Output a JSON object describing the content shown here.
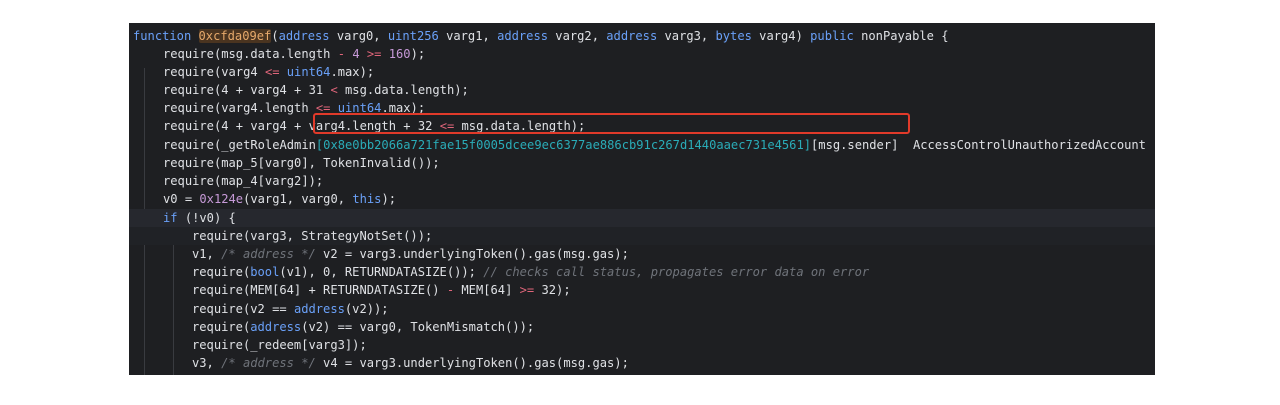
{
  "code": {
    "l1": {
      "kw": "function",
      "fname": "0xcfda09ef",
      "p1": "(",
      "t1": "address",
      "a1": " varg0, ",
      "t2": "uint256",
      "a2": " varg1, ",
      "t3": "address",
      "a3": " varg2, ",
      "t4": "address",
      "a4": " varg3, ",
      "t5": "bytes",
      "a5": " varg4) ",
      "k2": "public",
      "a6": " nonPayable {"
    },
    "l2": {
      "f": "require",
      "a": "(msg.data.length ",
      "op1": "-",
      "b": " ",
      "n1": "4",
      "c": " ",
      "op2": ">=",
      "d": " ",
      "n2": "160",
      "e": ");"
    },
    "l3": {
      "f": "require",
      "a": "(varg4 ",
      "op": "<=",
      "b": " ",
      "t": "uint64",
      "c": ".max);"
    },
    "l4": {
      "f": "require",
      "a": "(4 + varg4 + 31 ",
      "op": "<",
      "b": " msg.data.length);"
    },
    "l5": {
      "f": "require",
      "a": "(varg4.length ",
      "op": "<=",
      "b": " ",
      "t": "uint64",
      "c": ".max);"
    },
    "l6": {
      "f": "require",
      "a": "(4 + varg4 + varg4.length + 32 ",
      "op": "<=",
      "b": " msg.data.length);"
    },
    "l7": {
      "f": "require",
      "a": "(_getRoleAdmin",
      "hex": "[0x8e0bb2066a721fae15f0005dcee9ec6377ae886cb91c267d1440aaec731e4561]",
      "b": "[msg.sender]",
      "c": "  AccessControlUnauthorizedAccount"
    },
    "l8": {
      "f": "require",
      "a": "(map_5[varg0], TokenInvalid());"
    },
    "l9": {
      "f": "require",
      "a": "(map_4[varg2]);"
    },
    "l10": {
      "a": "v0 = ",
      "n": "0x124e",
      "b": "(varg1, varg0, ",
      "k": "this",
      "c": ");"
    },
    "l11": {
      "k": "if",
      "a": " (!v0) {"
    },
    "l12": {
      "f": "require",
      "a": "(varg3, StrategyNotSet());"
    },
    "l13": {
      "a": "v1, ",
      "c1": "/* address */",
      "b": " v2 = varg3.underlyingToken().gas(msg.gas);"
    },
    "l14": {
      "f": "require",
      "a": "(",
      "t": "bool",
      "b": "(v1), 0, RETURNDATASIZE()); ",
      "c": "// checks call status, propagates error data on error"
    },
    "l15": {
      "f": "require",
      "a": "(MEM[64] + RETURNDATASIZE() ",
      "op1": "-",
      "b": " MEM[64] ",
      "op2": ">=",
      "c": " 32);"
    },
    "l16": {
      "f": "require",
      "a": "(v2 == ",
      "t": "address",
      "b": "(v2));"
    },
    "l17": {
      "f": "require",
      "a": "(",
      "t": "address",
      "b": "(v2) == varg0, TokenMismatch());"
    },
    "l18": {
      "f": "require",
      "a": "(_redeem[varg3]);"
    },
    "l19": {
      "a": "v3, ",
      "c1": "/* address */",
      "b": " v4 = varg3.underlyingToken().gas(msg.gas);"
    }
  }
}
